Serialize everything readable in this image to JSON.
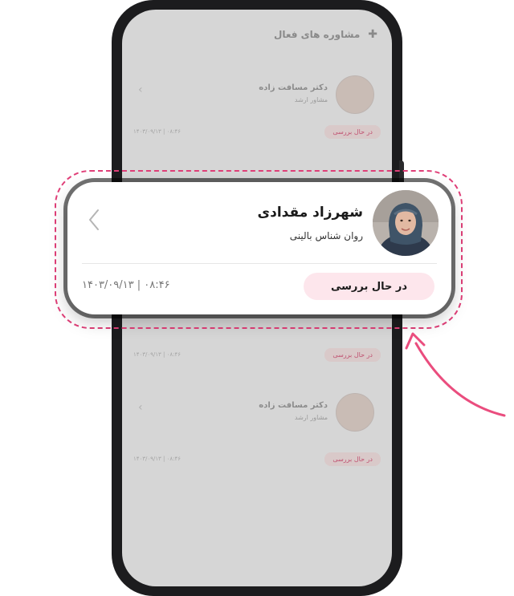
{
  "background_screen": {
    "title": "مشاوره های فعال",
    "items": [
      {
        "name": "دکتر مسافت زاده",
        "role": "مشاور ارشد",
        "status": "در حال بررسی",
        "date": "۱۴۰۳/۰۹/۱۳ | ۰۸:۴۶"
      },
      {
        "name": "دکتر مسافت زاده",
        "role": "مشاور ارشد",
        "status": "در حال بررسی",
        "date": "۱۴۰۳/۰۹/۱۳ | ۰۸:۴۶"
      },
      {
        "name": "دکتر مسافت زاده",
        "role": "مشاور ارشد",
        "status": "در حال بررسی",
        "date": "۱۴۰۳/۰۹/۱۳ | ۰۸:۴۶"
      }
    ]
  },
  "highlight_card": {
    "name": "شهرزاد مقدادی",
    "role": "روان شناس بالینی",
    "status": "در حال بررسی",
    "datetime": "۱۴۰۳/۰۹/۱۳ | ۰۸:۴۶"
  },
  "icons": {
    "chevron": "chevron-left-icon",
    "header": "plus-icon",
    "avatar": "user-photo",
    "annotation": "curved-arrow-icon"
  },
  "colors": {
    "accent_pink": "#e03f78",
    "status_bg": "#fde6ec",
    "phone_frame": "#1c1c1e",
    "screen_overlay": "#d6d6d6"
  }
}
